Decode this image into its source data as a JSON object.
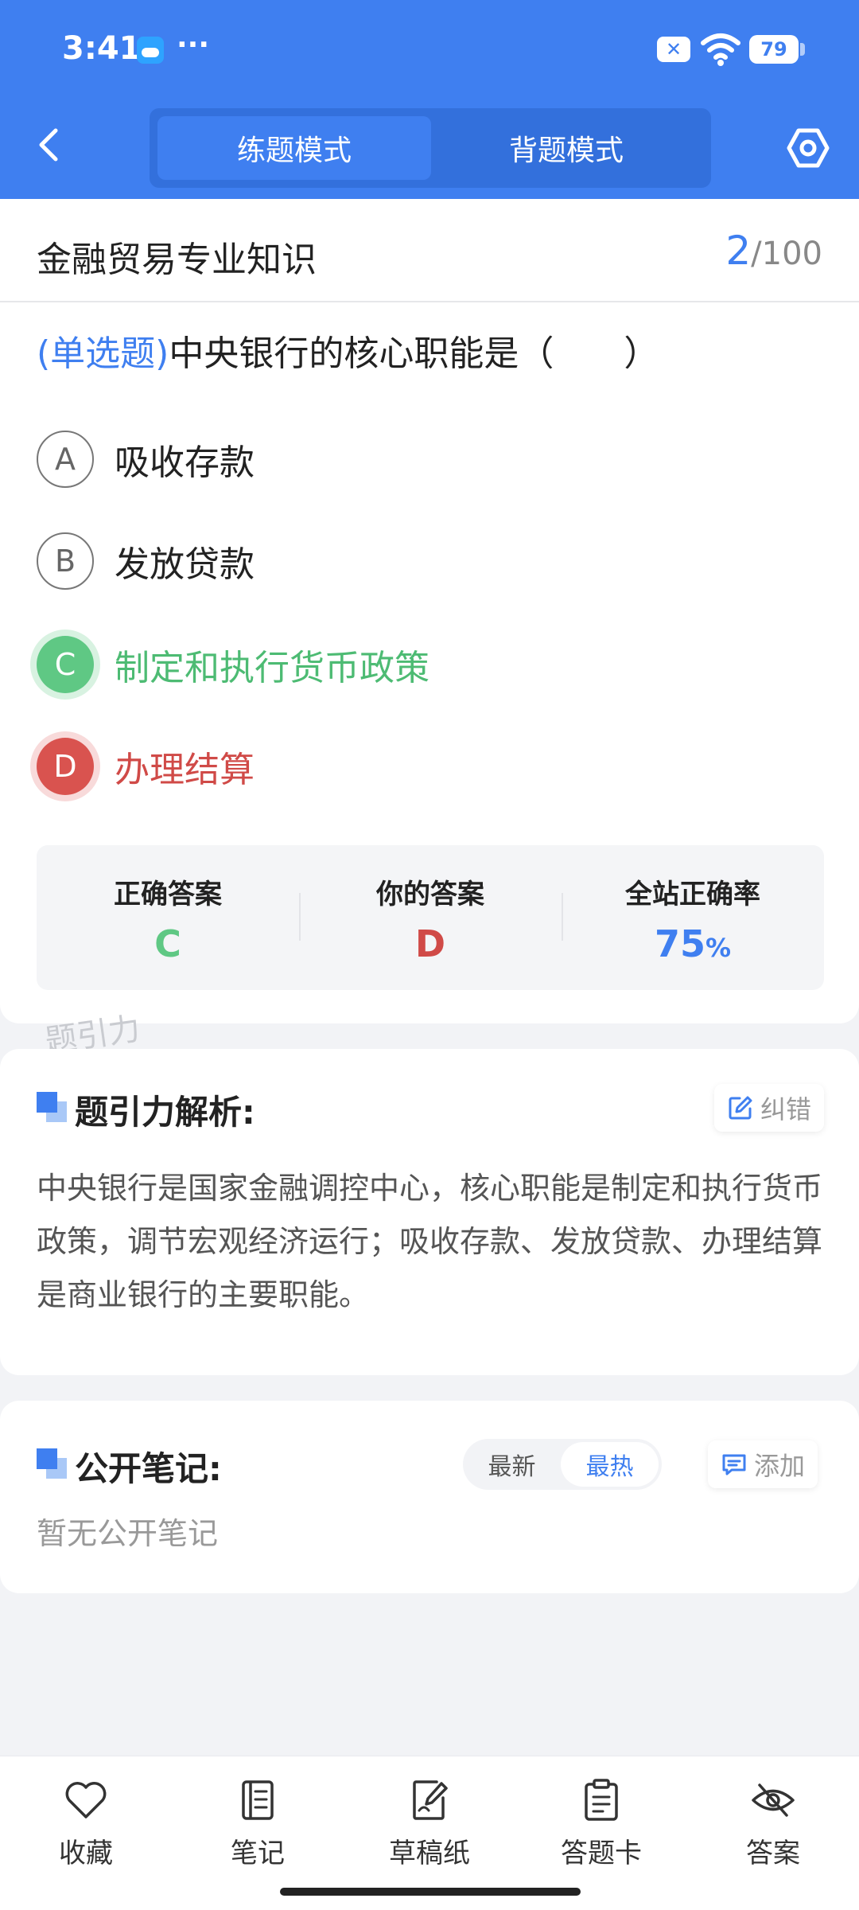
{
  "status_bar": {
    "time": "3:41",
    "dots": "···",
    "battery": "79",
    "x_badge": "✕"
  },
  "header": {
    "tabs": [
      {
        "label": "练题模式",
        "active": true
      },
      {
        "label": "背题模式",
        "active": false
      }
    ]
  },
  "main": {
    "subject": "金融贸易专业知识",
    "progress": {
      "current": "2",
      "total": "/100"
    },
    "question": {
      "type": "(单选题)",
      "text": "中央银行的核心职能是（　　）"
    },
    "options": [
      {
        "letter": "A",
        "text": "吸收存款",
        "state": "normal"
      },
      {
        "letter": "B",
        "text": "发放贷款",
        "state": "normal"
      },
      {
        "letter": "C",
        "text": "制定和执行货币政策",
        "state": "correct"
      },
      {
        "letter": "D",
        "text": "办理结算",
        "state": "wrong"
      }
    ],
    "answer": {
      "correct_label": "正确答案",
      "correct_value": "C",
      "yours_label": "你的答案",
      "yours_value": "D",
      "rate_label": "全站正确率",
      "rate_value": "75",
      "rate_unit": "%"
    },
    "watermark": "题引力"
  },
  "analysis": {
    "title": "题引力解析:",
    "report_label": "纠错",
    "text": "中央银行是国家金融调控中心，核心职能是制定和执行货币政策，调节宏观经济运行；吸收存款、发放贷款、办理结算是商业银行的主要职能。"
  },
  "notes": {
    "title": "公开笔记:",
    "sort": [
      {
        "label": "最新",
        "active": false
      },
      {
        "label": "最热",
        "active": true
      }
    ],
    "add_label": "添加",
    "empty_text": "暂无公开笔记"
  },
  "bottom_nav": [
    {
      "label": "收藏",
      "icon": "heart-icon"
    },
    {
      "label": "笔记",
      "icon": "notebook-icon"
    },
    {
      "label": "草稿纸",
      "icon": "draft-icon"
    },
    {
      "label": "答题卡",
      "icon": "clipboard-icon"
    },
    {
      "label": "答案",
      "icon": "eye-off-icon"
    }
  ],
  "colors": {
    "primary": "#3f7ff0",
    "correct": "#5fc884",
    "wrong": "#d04a47"
  }
}
